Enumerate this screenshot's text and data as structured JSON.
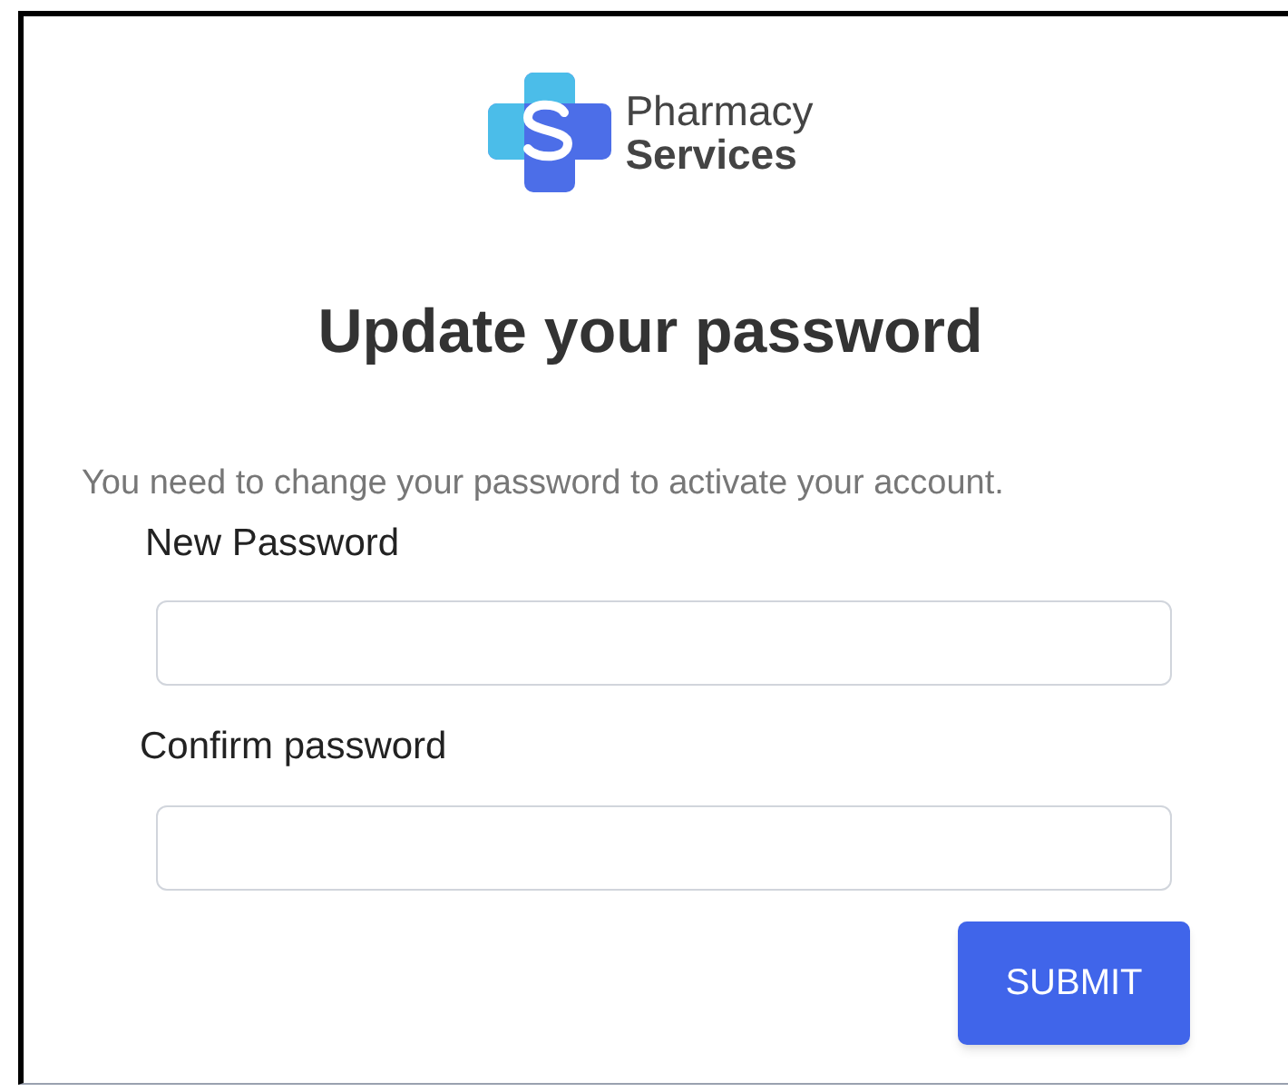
{
  "logo": {
    "line_1": "Pharmacy",
    "line_2": "Services"
  },
  "title": "Update your password",
  "message": "You need to change your password to activate your account.",
  "fields": [
    {
      "label": "New Password"
    },
    {
      "label": "Confirm password"
    }
  ],
  "submit_button": "SUBMIT"
}
